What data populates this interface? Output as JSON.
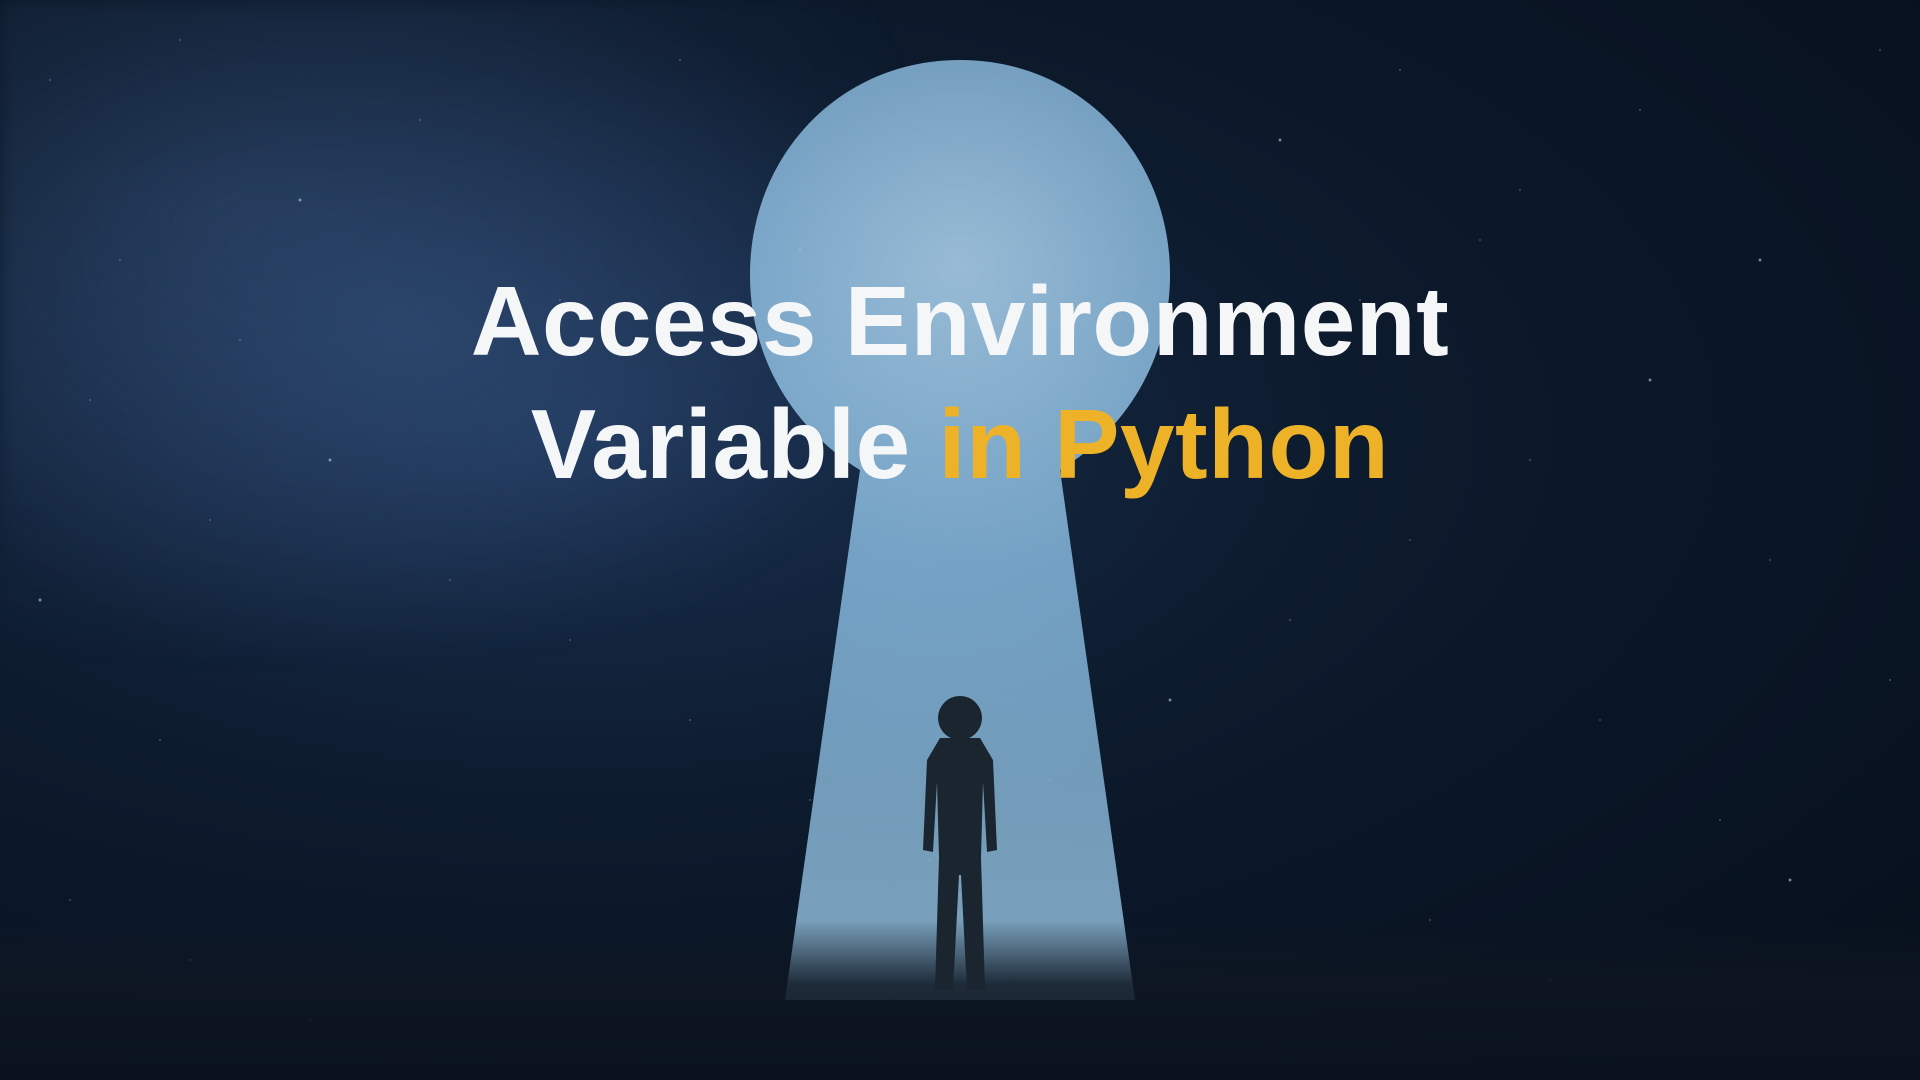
{
  "title": {
    "line1": "Access Environment",
    "line2_part1": "Variable ",
    "line2_part2": "in Python"
  },
  "colors": {
    "accent": "#edb227",
    "text": "#f5f6f7",
    "background": "#0a1525"
  },
  "graphic": {
    "description": "Silhouette of a person in a suit standing before a large glowing keyhole opening against a starry night sky"
  }
}
